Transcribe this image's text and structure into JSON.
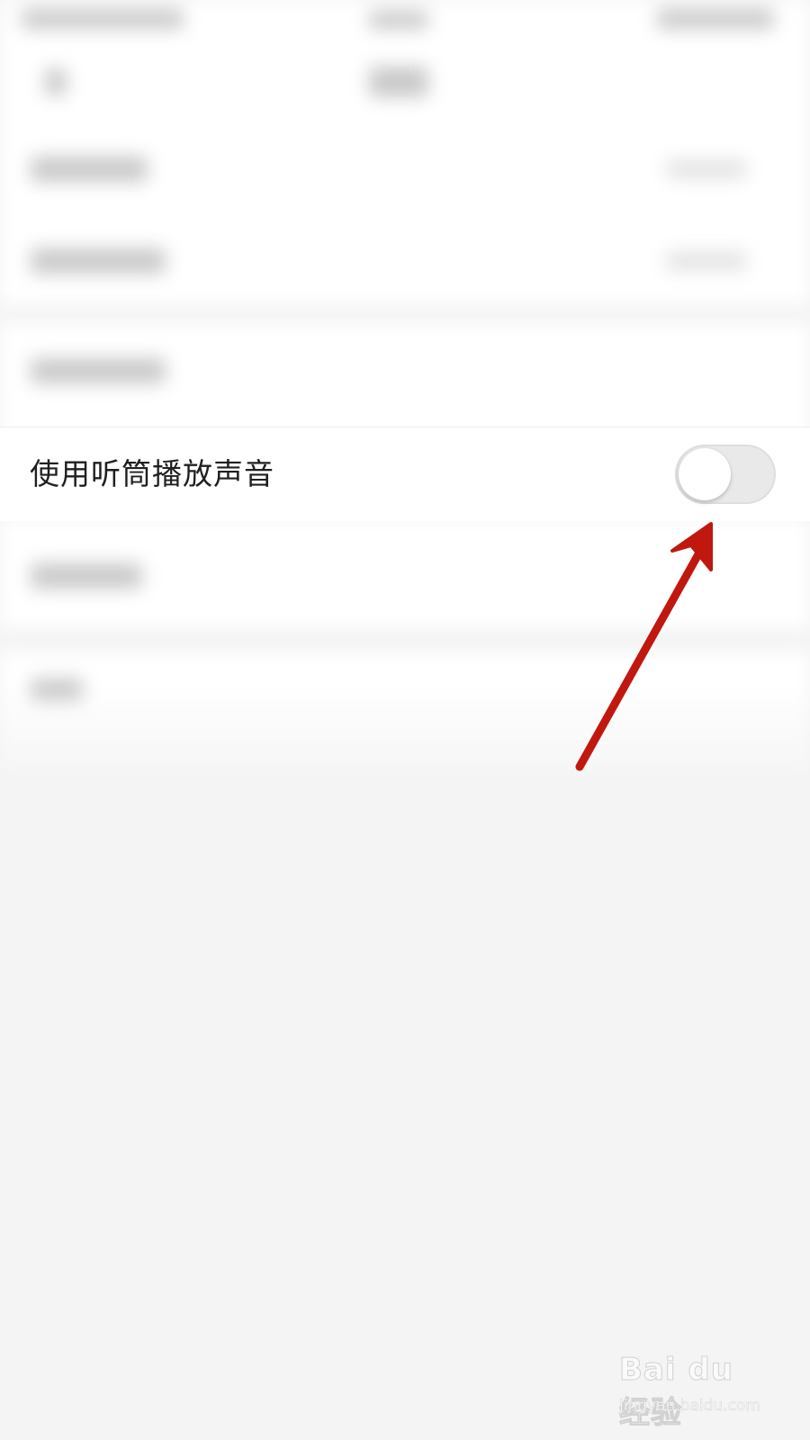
{
  "settings": {
    "row": {
      "label": "使用听筒播放声音",
      "toggle_state": "off"
    }
  },
  "annotation": {
    "color": "#c0180f",
    "icon": "red-arrow-icon"
  },
  "watermark": {
    "logo_text": "Bai du 经验",
    "url": "jingyan.baidu.com"
  }
}
